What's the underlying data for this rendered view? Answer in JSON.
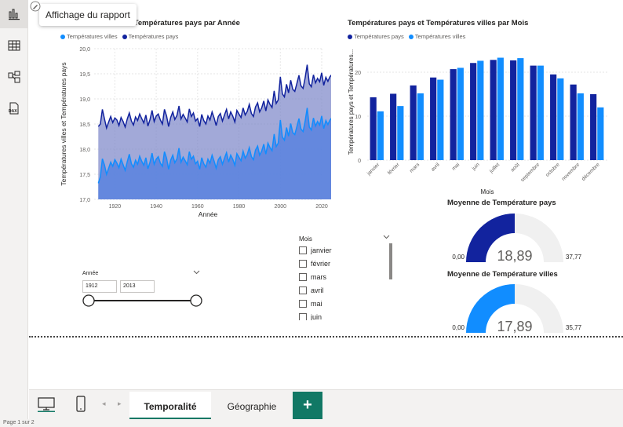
{
  "tooltip": "Affichage du rapport",
  "rail": {
    "icons": [
      "report-view-icon",
      "table-view-icon",
      "model-view-icon",
      "dax-query-icon"
    ],
    "dax_label": "DAX"
  },
  "colors": {
    "pays": "#12239e",
    "villes": "#118dff",
    "track": "#f0f0f0",
    "tab_accent": "#117865"
  },
  "chart_data": [
    {
      "type": "area",
      "title": "t Températures pays par Année",
      "legend": [
        "Températures villes",
        "Températures pays"
      ],
      "xlabel": "Année",
      "ylabel": "Températures villes et Températures pays",
      "xlim": [
        1910,
        2020
      ],
      "ylim": [
        17.0,
        20.0
      ],
      "x_ticks": [
        "1920",
        "1940",
        "1960",
        "1980",
        "2000",
        "2020"
      ],
      "y_ticks": [
        "17,0",
        "17,5",
        "18,0",
        "18,5",
        "19,0",
        "19,5",
        "20,0"
      ],
      "x_start": 1912,
      "series": [
        {
          "name": "Températures villes",
          "values": [
            17.32,
            17.45,
            17.81,
            17.68,
            17.5,
            17.62,
            17.74,
            17.66,
            17.79,
            17.72,
            17.63,
            17.8,
            17.69,
            17.58,
            17.75,
            17.9,
            17.71,
            17.64,
            17.78,
            17.7,
            17.86,
            17.76,
            17.68,
            17.83,
            17.61,
            17.74,
            17.92,
            17.7,
            17.8,
            17.85,
            17.72,
            17.66,
            17.95,
            17.82,
            17.6,
            17.78,
            17.88,
            17.73,
            17.81,
            18.02,
            17.74,
            17.84,
            17.77,
            17.69,
            17.95,
            17.8,
            17.86,
            17.71,
            17.76,
            17.6,
            17.83,
            17.71,
            17.64,
            17.8,
            17.72,
            17.88,
            17.76,
            17.62,
            17.79,
            17.85,
            17.7,
            17.82,
            17.93,
            17.74,
            17.88,
            17.8,
            17.68,
            17.91,
            17.84,
            17.77,
            17.96,
            17.82,
            17.89,
            18.03,
            17.85,
            17.79,
            17.98,
            18.06,
            17.88,
            17.96,
            18.1,
            17.9,
            18.12,
            18.03,
            17.97,
            18.3,
            18.05,
            18.12,
            18.58,
            18.24,
            18.18,
            18.43,
            18.26,
            18.51,
            18.33,
            18.29,
            18.45,
            18.61,
            18.4,
            18.35,
            18.56,
            18.82,
            18.44,
            18.38,
            18.62,
            18.46,
            18.55,
            18.48,
            18.66,
            18.41,
            18.57,
            18.49,
            18.58,
            18.63,
            18.54,
            18.44,
            18.6,
            19.06
          ]
        },
        {
          "name": "Températures pays",
          "values": [
            18.45,
            18.5,
            18.79,
            18.6,
            18.42,
            18.54,
            18.65,
            18.53,
            18.62,
            18.58,
            18.47,
            18.63,
            18.55,
            18.44,
            18.6,
            18.72,
            18.56,
            18.48,
            18.64,
            18.57,
            18.7,
            18.61,
            18.52,
            18.68,
            18.46,
            18.59,
            18.77,
            18.55,
            18.66,
            18.7,
            18.58,
            18.5,
            18.79,
            18.66,
            18.45,
            18.63,
            18.74,
            18.59,
            18.67,
            18.86,
            18.6,
            18.69,
            18.62,
            18.54,
            18.8,
            18.65,
            18.72,
            18.56,
            18.61,
            18.45,
            18.69,
            18.57,
            18.5,
            18.66,
            18.58,
            18.74,
            18.62,
            18.47,
            18.65,
            18.71,
            18.56,
            18.68,
            18.79,
            18.6,
            18.74,
            18.66,
            18.54,
            18.77,
            18.7,
            18.63,
            18.82,
            18.68,
            18.75,
            18.89,
            18.71,
            18.65,
            18.84,
            18.92,
            18.74,
            18.82,
            18.96,
            18.76,
            18.98,
            18.89,
            18.83,
            19.16,
            18.91,
            18.98,
            19.44,
            19.1,
            19.04,
            19.29,
            19.12,
            19.37,
            19.19,
            19.15,
            19.31,
            19.47,
            19.26,
            19.21,
            19.42,
            19.68,
            19.3,
            19.24,
            19.48,
            19.32,
            19.41,
            19.34,
            19.52,
            19.27,
            19.43,
            19.35,
            19.44,
            19.49,
            19.4,
            19.3,
            19.46,
            19.9
          ]
        }
      ]
    },
    {
      "type": "bar",
      "title": "Températures pays et Températures villes par Mois",
      "legend": [
        "Températures pays",
        "Températures villes"
      ],
      "xlabel": "Mois",
      "ylabel": "Températures pays et Températures...",
      "ylim": [
        0,
        25
      ],
      "y_ticks": [
        "0",
        "10",
        "20"
      ],
      "categories": [
        "janvier",
        "février",
        "mars",
        "avril",
        "mai",
        "juin",
        "juillet",
        "août",
        "septembre",
        "octobre",
        "novembre",
        "décembre"
      ],
      "series": [
        {
          "name": "Températures pays",
          "values": [
            14.3,
            15.1,
            17.0,
            18.8,
            20.7,
            22.1,
            22.8,
            22.7,
            21.5,
            19.5,
            17.2,
            15.0
          ]
        },
        {
          "name": "Températures villes",
          "values": [
            11.1,
            12.3,
            15.2,
            18.3,
            21.0,
            22.6,
            23.3,
            23.2,
            21.5,
            18.6,
            15.2,
            12.0
          ]
        }
      ]
    }
  ],
  "gauges": [
    {
      "title": "Moyenne de Température pays",
      "value_label": "18,89",
      "value": 18.89,
      "min_label": "0,00",
      "max_label": "37,77",
      "max": 37.77,
      "series": "pays"
    },
    {
      "title": "Moyenne de Température villes",
      "value_label": "17,89",
      "value": 17.89,
      "min_label": "0,00",
      "max_label": "35,77",
      "max": 35.77,
      "series": "villes"
    }
  ],
  "annee_slicer": {
    "label": "Année",
    "from": "1912",
    "to": "2013"
  },
  "mois_slicer": {
    "label": "Mois",
    "items": [
      "janvier",
      "février",
      "mars",
      "avril",
      "mai",
      "juin"
    ]
  },
  "tabs": [
    {
      "label": "Temporalité",
      "active": true
    },
    {
      "label": "Géographie",
      "active": false
    }
  ],
  "add_tab": "+",
  "statusbar": "Page 1 sur 2"
}
